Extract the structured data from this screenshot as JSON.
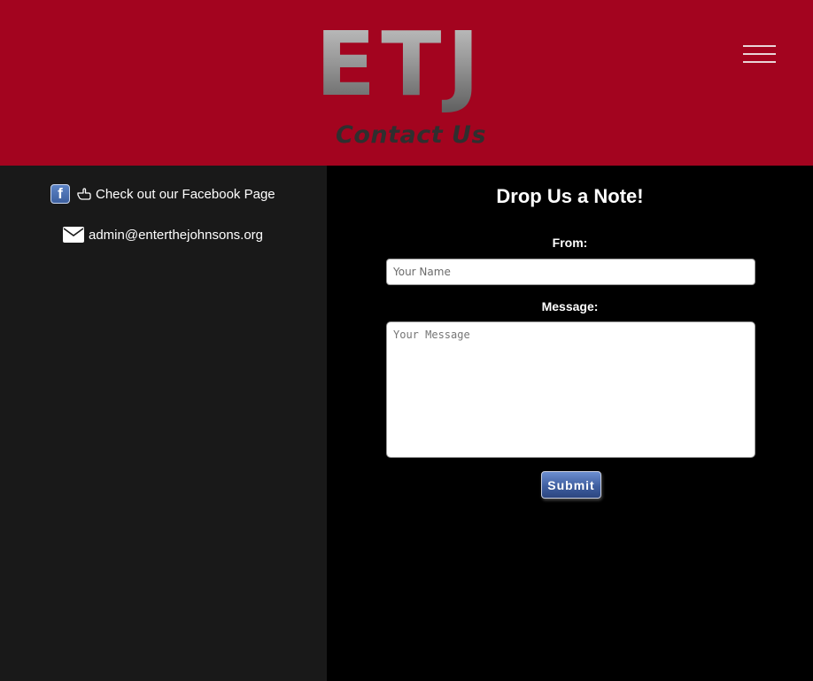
{
  "header": {
    "logo_text": "ETJ",
    "page_title": "Contact Us",
    "menu_icon": "hamburger-menu-icon"
  },
  "sidebar": {
    "facebook": {
      "icon": "facebook-icon",
      "glyph": "f",
      "pointer_icon": "pointing-hand-icon",
      "label": "Check out our Facebook Page"
    },
    "email": {
      "icon": "envelope-icon",
      "label": "admin@enterthejohnsons.org"
    }
  },
  "form": {
    "title": "Drop Us a Note!",
    "from_label": "From:",
    "name_placeholder": "Your Name",
    "name_value": "",
    "message_label": "Message:",
    "message_placeholder": "Your Message",
    "message_value": "",
    "submit_label": "Submit"
  },
  "colors": {
    "header_bg": "#a3041f",
    "sidebar_bg": "#191919",
    "main_bg": "#000000",
    "submit_button": "#3f5fa0"
  }
}
